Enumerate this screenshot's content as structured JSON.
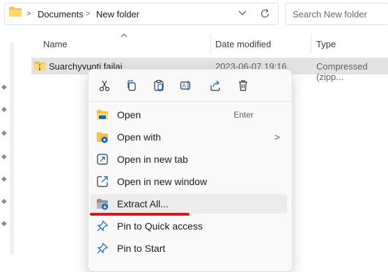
{
  "address": {
    "crumbs": [
      "Documents",
      "New folder"
    ],
    "separator": ">",
    "dropdown_icon": "chevron-down-icon",
    "refresh_icon": "refresh-icon"
  },
  "search": {
    "placeholder": "Search New folder"
  },
  "columns": {
    "name": "Name",
    "date": "Date modified",
    "type": "Type"
  },
  "file": {
    "name": "Suarchyvuoti failai",
    "date": "2023-06-07 19:16",
    "type": "Compressed (zipp..."
  },
  "menu": {
    "toolbar": [
      "cut-icon",
      "copy-icon",
      "paste-icon",
      "rename-icon",
      "share-icon",
      "delete-icon"
    ],
    "items": [
      {
        "label": "Open",
        "accel": "Enter",
        "icon": "folder-open-icon"
      },
      {
        "label": "Open with",
        "submenu": ">",
        "icon": "open-with-icon"
      },
      {
        "label": "Open in new tab",
        "icon": "new-tab-icon"
      },
      {
        "label": "Open in new window",
        "icon": "new-window-icon"
      },
      {
        "label": "Extract All...",
        "icon": "extract-icon"
      },
      {
        "label": "Pin to Quick access",
        "icon": "pin-icon"
      },
      {
        "label": "Pin to Start",
        "icon": "pin-icon"
      }
    ]
  },
  "colors": {
    "accent": "#0a64d6",
    "highlight": "#e0121b",
    "folder": "#f3c04c"
  }
}
